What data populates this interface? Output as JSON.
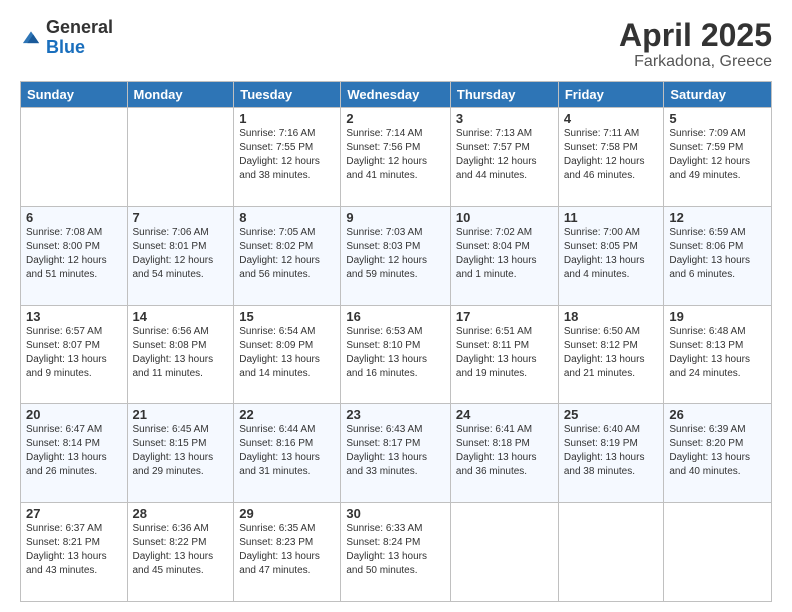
{
  "logo": {
    "general": "General",
    "blue": "Blue"
  },
  "header": {
    "month": "April 2025",
    "location": "Farkadona, Greece"
  },
  "weekdays": [
    "Sunday",
    "Monday",
    "Tuesday",
    "Wednesday",
    "Thursday",
    "Friday",
    "Saturday"
  ],
  "weeks": [
    [
      {
        "day": "",
        "info": ""
      },
      {
        "day": "",
        "info": ""
      },
      {
        "day": "1",
        "info": "Sunrise: 7:16 AM\nSunset: 7:55 PM\nDaylight: 12 hours and 38 minutes."
      },
      {
        "day": "2",
        "info": "Sunrise: 7:14 AM\nSunset: 7:56 PM\nDaylight: 12 hours and 41 minutes."
      },
      {
        "day": "3",
        "info": "Sunrise: 7:13 AM\nSunset: 7:57 PM\nDaylight: 12 hours and 44 minutes."
      },
      {
        "day": "4",
        "info": "Sunrise: 7:11 AM\nSunset: 7:58 PM\nDaylight: 12 hours and 46 minutes."
      },
      {
        "day": "5",
        "info": "Sunrise: 7:09 AM\nSunset: 7:59 PM\nDaylight: 12 hours and 49 minutes."
      }
    ],
    [
      {
        "day": "6",
        "info": "Sunrise: 7:08 AM\nSunset: 8:00 PM\nDaylight: 12 hours and 51 minutes."
      },
      {
        "day": "7",
        "info": "Sunrise: 7:06 AM\nSunset: 8:01 PM\nDaylight: 12 hours and 54 minutes."
      },
      {
        "day": "8",
        "info": "Sunrise: 7:05 AM\nSunset: 8:02 PM\nDaylight: 12 hours and 56 minutes."
      },
      {
        "day": "9",
        "info": "Sunrise: 7:03 AM\nSunset: 8:03 PM\nDaylight: 12 hours and 59 minutes."
      },
      {
        "day": "10",
        "info": "Sunrise: 7:02 AM\nSunset: 8:04 PM\nDaylight: 13 hours and 1 minute."
      },
      {
        "day": "11",
        "info": "Sunrise: 7:00 AM\nSunset: 8:05 PM\nDaylight: 13 hours and 4 minutes."
      },
      {
        "day": "12",
        "info": "Sunrise: 6:59 AM\nSunset: 8:06 PM\nDaylight: 13 hours and 6 minutes."
      }
    ],
    [
      {
        "day": "13",
        "info": "Sunrise: 6:57 AM\nSunset: 8:07 PM\nDaylight: 13 hours and 9 minutes."
      },
      {
        "day": "14",
        "info": "Sunrise: 6:56 AM\nSunset: 8:08 PM\nDaylight: 13 hours and 11 minutes."
      },
      {
        "day": "15",
        "info": "Sunrise: 6:54 AM\nSunset: 8:09 PM\nDaylight: 13 hours and 14 minutes."
      },
      {
        "day": "16",
        "info": "Sunrise: 6:53 AM\nSunset: 8:10 PM\nDaylight: 13 hours and 16 minutes."
      },
      {
        "day": "17",
        "info": "Sunrise: 6:51 AM\nSunset: 8:11 PM\nDaylight: 13 hours and 19 minutes."
      },
      {
        "day": "18",
        "info": "Sunrise: 6:50 AM\nSunset: 8:12 PM\nDaylight: 13 hours and 21 minutes."
      },
      {
        "day": "19",
        "info": "Sunrise: 6:48 AM\nSunset: 8:13 PM\nDaylight: 13 hours and 24 minutes."
      }
    ],
    [
      {
        "day": "20",
        "info": "Sunrise: 6:47 AM\nSunset: 8:14 PM\nDaylight: 13 hours and 26 minutes."
      },
      {
        "day": "21",
        "info": "Sunrise: 6:45 AM\nSunset: 8:15 PM\nDaylight: 13 hours and 29 minutes."
      },
      {
        "day": "22",
        "info": "Sunrise: 6:44 AM\nSunset: 8:16 PM\nDaylight: 13 hours and 31 minutes."
      },
      {
        "day": "23",
        "info": "Sunrise: 6:43 AM\nSunset: 8:17 PM\nDaylight: 13 hours and 33 minutes."
      },
      {
        "day": "24",
        "info": "Sunrise: 6:41 AM\nSunset: 8:18 PM\nDaylight: 13 hours and 36 minutes."
      },
      {
        "day": "25",
        "info": "Sunrise: 6:40 AM\nSunset: 8:19 PM\nDaylight: 13 hours and 38 minutes."
      },
      {
        "day": "26",
        "info": "Sunrise: 6:39 AM\nSunset: 8:20 PM\nDaylight: 13 hours and 40 minutes."
      }
    ],
    [
      {
        "day": "27",
        "info": "Sunrise: 6:37 AM\nSunset: 8:21 PM\nDaylight: 13 hours and 43 minutes."
      },
      {
        "day": "28",
        "info": "Sunrise: 6:36 AM\nSunset: 8:22 PM\nDaylight: 13 hours and 45 minutes."
      },
      {
        "day": "29",
        "info": "Sunrise: 6:35 AM\nSunset: 8:23 PM\nDaylight: 13 hours and 47 minutes."
      },
      {
        "day": "30",
        "info": "Sunrise: 6:33 AM\nSunset: 8:24 PM\nDaylight: 13 hours and 50 minutes."
      },
      {
        "day": "",
        "info": ""
      },
      {
        "day": "",
        "info": ""
      },
      {
        "day": "",
        "info": ""
      }
    ]
  ]
}
